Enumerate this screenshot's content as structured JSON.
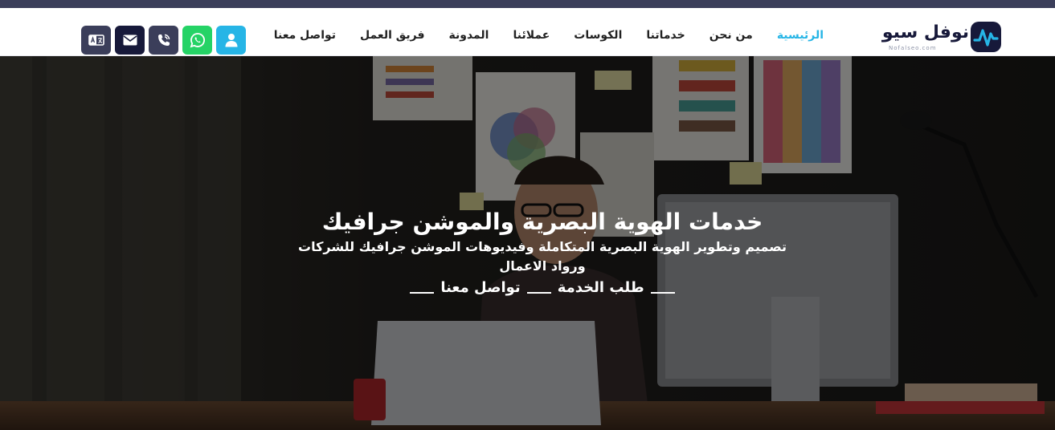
{
  "logo": {
    "text": "نوفل سيو",
    "subtext": "Nofalseo.com"
  },
  "nav": {
    "items": [
      {
        "label": "الرئيسية",
        "active": true
      },
      {
        "label": "من نحن"
      },
      {
        "label": "خدماتنا"
      },
      {
        "label": "الكوسات"
      },
      {
        "label": "عملائنا"
      },
      {
        "label": "المدونة"
      },
      {
        "label": "فريق العمل"
      },
      {
        "label": "تواصل معنا"
      }
    ]
  },
  "header_icons": [
    {
      "icon": "user-icon",
      "color": "#26b5e6"
    },
    {
      "icon": "whatsapp-icon",
      "color": "#25d366"
    },
    {
      "icon": "viber-icon",
      "color": "#3b3e5a"
    },
    {
      "icon": "envelope-icon",
      "color": "#17193a"
    },
    {
      "icon": "language-icon",
      "color": "#3b3e5a"
    }
  ],
  "hero": {
    "title": "خدمات الهوية البصرية والموشن جرافيك",
    "subtitle": "تصميم وتطوير الهوية البصرية المتكاملة وفيديوهات الموشن جرافيك للشركات ورواد الاعمال",
    "cta_request": "طلب الخدمة",
    "cta_contact": "تواصل معنا"
  },
  "colors": {
    "accent": "#26b5e6",
    "dark_navy": "#3b3e5a",
    "whatsapp": "#25d366"
  }
}
